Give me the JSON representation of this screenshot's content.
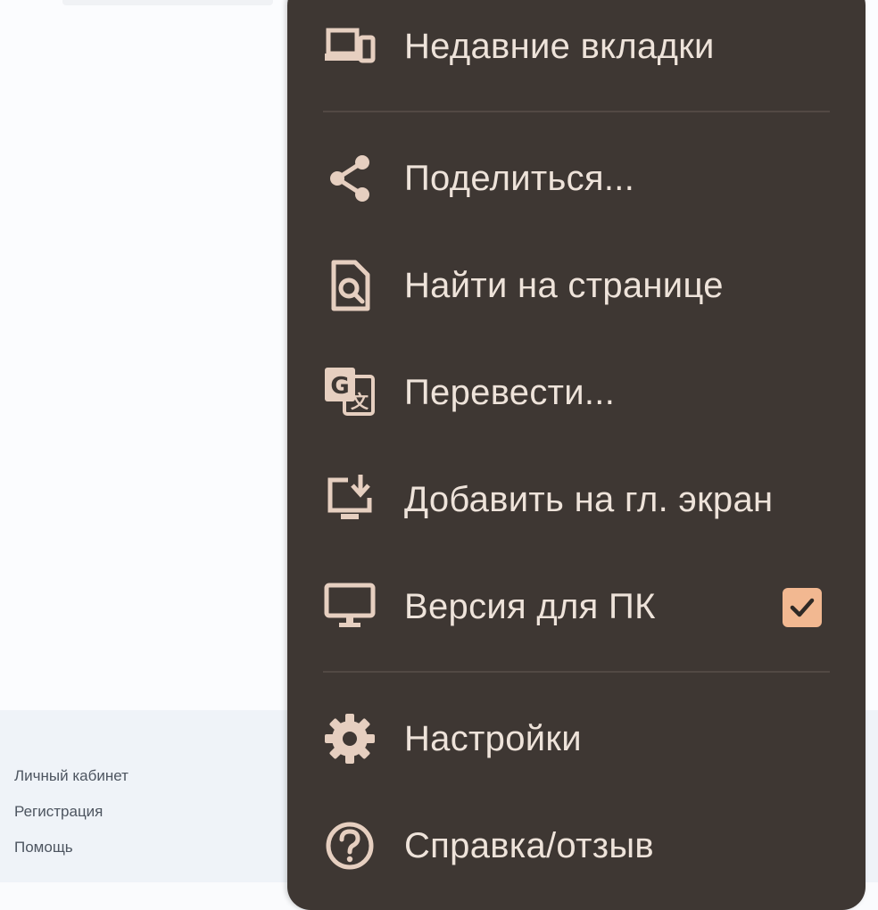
{
  "menu": {
    "items": [
      {
        "label": "Недавние вкладки",
        "icon": "recent-tabs-icon"
      },
      {
        "label": "Поделиться...",
        "icon": "share-icon"
      },
      {
        "label": "Найти на странице",
        "icon": "find-in-page-icon"
      },
      {
        "label": "Перевести...",
        "icon": "translate-icon"
      },
      {
        "label": "Добавить на гл. экран",
        "icon": "add-to-home-screen-icon"
      },
      {
        "label": "Версия для ПК",
        "icon": "desktop-icon",
        "checked": true
      },
      {
        "label": "Настройки",
        "icon": "gear-icon"
      },
      {
        "label": "Справка/отзыв",
        "icon": "help-icon"
      }
    ]
  },
  "footer": {
    "links": [
      "Личный кабинет",
      "Регистрация",
      "Помощь"
    ]
  },
  "colors": {
    "menu_background": "#3e3733",
    "menu_text": "#eee3da",
    "icon": "#e6cfc0",
    "checkbox_accent": "#f2b891",
    "page_background": "#fbfcfe",
    "footer_background": "#eff3f8"
  }
}
